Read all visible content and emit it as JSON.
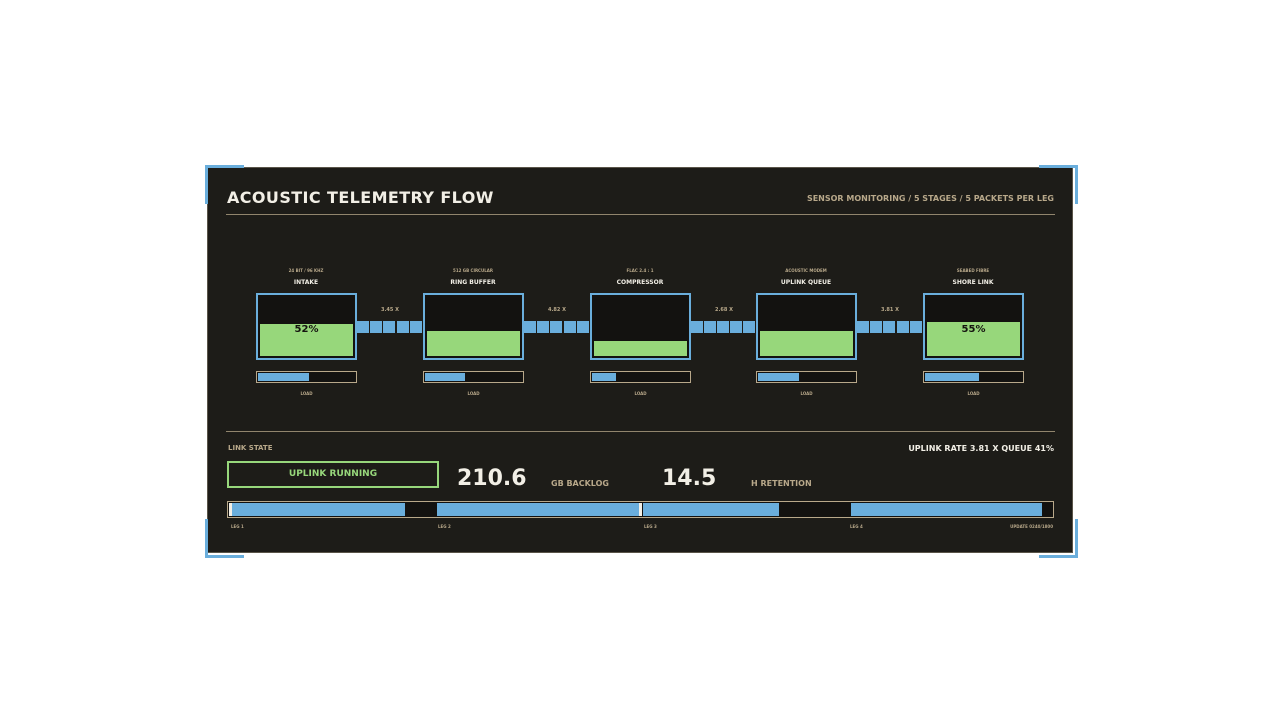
{
  "header": {
    "title": "ACOUSTIC TELEMETRY FLOW",
    "subtitle": "SENSOR MONITORING / 5 STAGES / 5 PACKETS PER LEG"
  },
  "colors": {
    "accent_blue": "#6aaedc",
    "fill_green": "#97d77b",
    "panel_bg": "#1d1c18",
    "muted_text": "#b8a88a"
  },
  "stages": [
    {
      "name": "INTAKE",
      "sub": "24 BIT / 96 KHZ",
      "pct_label": "52%",
      "level": 0.52,
      "load": 0.52,
      "load_label": "LOAD"
    },
    {
      "name": "RING BUFFER",
      "sub": "512 GB CIRCULAR",
      "pct_label": "",
      "level": 0.41,
      "load": 0.4,
      "load_label": "LOAD"
    },
    {
      "name": "COMPRESSOR",
      "sub": "FLAC 2.4 : 1",
      "pct_label": "",
      "level": 0.24,
      "load": 0.24,
      "load_label": "LOAD"
    },
    {
      "name": "UPLINK QUEUE",
      "sub": "ACOUSTIC MODEM",
      "pct_label": "",
      "level": 0.41,
      "load": 0.41,
      "load_label": "LOAD"
    },
    {
      "name": "SHORE LINK",
      "sub": "SEABED FIBRE",
      "pct_label": "55%",
      "level": 0.55,
      "load": 0.55,
      "load_label": "LOAD"
    }
  ],
  "connectors": [
    {
      "ratio": "3.45 X"
    },
    {
      "ratio": "4.82 X"
    },
    {
      "ratio": "2.68 X"
    },
    {
      "ratio": "3.81 X"
    }
  ],
  "link": {
    "state_label": "LINK STATE",
    "status": "UPLINK RUNNING",
    "uplink_info": "UPLINK RATE 3.81 X   QUEUE  41%",
    "backlog_value": "210.6",
    "backlog_label": "GB BACKLOG",
    "retention_value": "14.5",
    "retention_label": "H RETENTION"
  },
  "timeline": {
    "legs": [
      "LEG 1",
      "LEG 2",
      "LEG 3",
      "LEG 4"
    ],
    "update": "UPDATE 0240/1800",
    "blocks": [
      {
        "start": 0.0,
        "end": 0.214
      },
      {
        "start": 0.253,
        "end": 0.498
      },
      {
        "start": 0.503,
        "end": 0.668
      },
      {
        "start": 0.756,
        "end": 0.988
      }
    ],
    "markers": [
      0.0,
      0.498
    ]
  }
}
